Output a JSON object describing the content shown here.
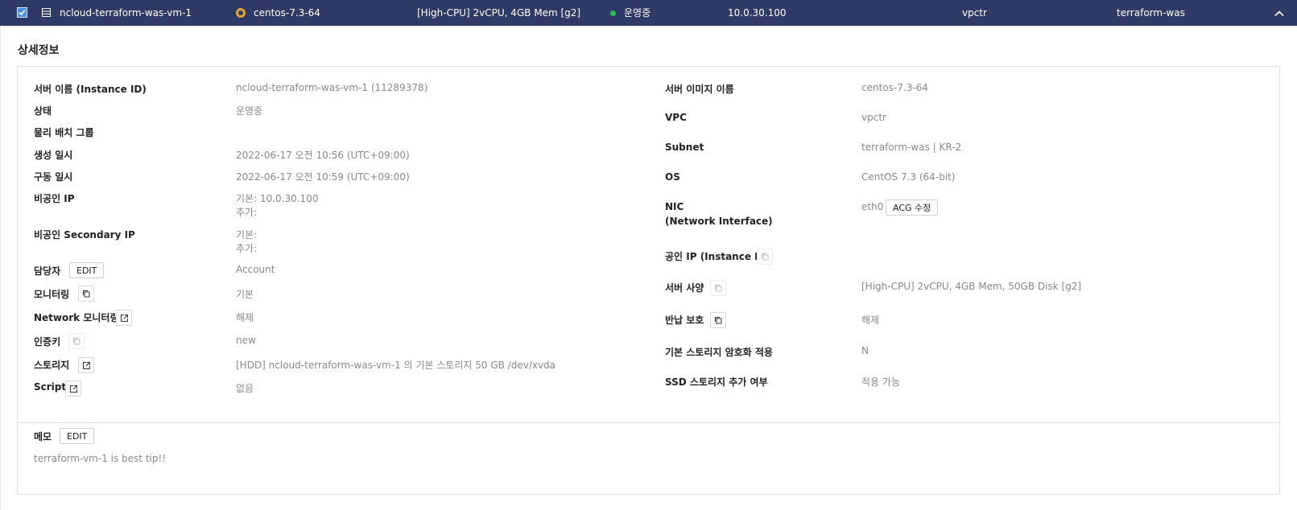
{
  "header": {
    "server_name": "ncloud-terraform-was-vm-1",
    "image": "centos-7.3-64",
    "spec": "[High-CPU] 2vCPU, 4GB Mem [g2]",
    "status": "운영중",
    "status_color": "#27c24c",
    "ip": "10.0.30.100",
    "vpc": "vpctr",
    "subnet": "terraform-was",
    "bg_color": "#2f3b66"
  },
  "detail": {
    "title": "상세정보",
    "left": {
      "server_name": {
        "label": "서버 이름 (Instance ID)",
        "value": "ncloud-terraform-was-vm-1 (11289378)"
      },
      "status": {
        "label": "상태",
        "value": "운영중"
      },
      "placement_group": {
        "label": "물리 배치 그룹",
        "value": ""
      },
      "created": {
        "label": "생성 일시",
        "value": "2022-06-17 오전 10:56 (UTC+09:00)"
      },
      "started": {
        "label": "구동 일시",
        "value": "2022-06-17 오전 10:59 (UTC+09:00)"
      },
      "private_ip": {
        "label": "비공인 IP",
        "value_main": "기본: 10.0.30.100",
        "value_extra": "추가:"
      },
      "secondary_ip": {
        "label": "비공인 Secondary IP",
        "value_main": "기본:",
        "value_extra": "추가:"
      },
      "manager": {
        "label": "담당자",
        "button": "EDIT",
        "value": "Account"
      },
      "monitoring": {
        "label": "모니터링",
        "value": "기본"
      },
      "network_monitoring": {
        "label": "Network 모니터링",
        "value": "해제"
      },
      "auth_key": {
        "label": "인증키",
        "value": "new"
      },
      "storage": {
        "label": "스토리지",
        "value": "[HDD] ncloud-terraform-was-vm-1 의 기본 스토리지  50 GB /dev/xvda"
      },
      "script": {
        "label": "Script",
        "value": "없음"
      }
    },
    "right": {
      "image_name": {
        "label": "서버 이미지 이름",
        "value": "centos-7.3-64"
      },
      "vpc": {
        "label": "VPC",
        "value": "vpctr"
      },
      "subnet": {
        "label": "Subnet",
        "value": "terraform-was | KR-2"
      },
      "os": {
        "label": "OS",
        "value": "CentOS 7.3 (64-bit)"
      },
      "nic": {
        "label_line1": "NIC",
        "label_line2": "(Network Interface)",
        "value": "eth0",
        "button": "ACG 수정"
      },
      "public_ip": {
        "label": "공인 IP (Instance ID)",
        "value": ""
      },
      "server_spec": {
        "label": "서버 사양",
        "value": "[High-CPU] 2vCPU, 4GB Mem, 50GB Disk [g2]"
      },
      "return_protection": {
        "label": "반납 보호",
        "value": "해제"
      },
      "storage_encryption": {
        "label": "기본 스토리지 암호화 적용",
        "value": "N"
      },
      "ssd_add": {
        "label": "SSD 스토리지 추가 여부",
        "value": "적용 가능"
      }
    },
    "memo": {
      "label": "메모",
      "button": "EDIT",
      "value": "terraform-vm-1 is best tip!!"
    }
  }
}
